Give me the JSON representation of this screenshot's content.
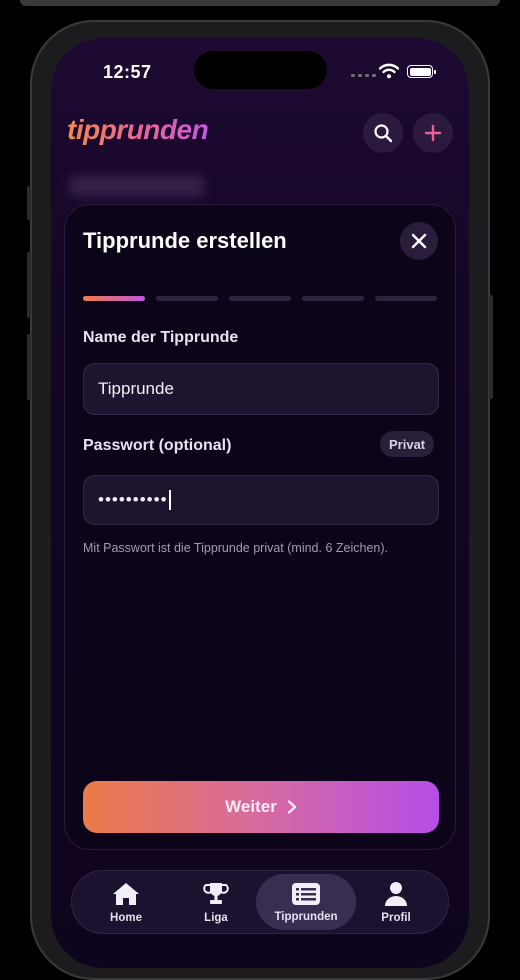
{
  "status": {
    "time": "12:57"
  },
  "app": {
    "logo": "tipprunden"
  },
  "header_actions": {
    "search_icon": "search-icon",
    "add_icon": "plus-icon"
  },
  "modal": {
    "title": "Tipprunde erstellen",
    "steps_total": 5,
    "step_current": 1,
    "name_label": "Name der Tipprunde",
    "name_value": "Tipprunde",
    "password_label": "Passwort (optional)",
    "privacy_badge": "Privat",
    "password_value": "••••••••••",
    "hint": "Mit Passwort ist die Tipprunde privat (mind. 6 Zeichen).",
    "next_button": "Weiter"
  },
  "tabs": [
    {
      "label": "Home",
      "icon": "home-icon"
    },
    {
      "label": "Liga",
      "icon": "trophy-icon"
    },
    {
      "label": "Tipprunden",
      "icon": "list-card-icon",
      "active": true
    },
    {
      "label": "Profil",
      "icon": "person-icon"
    }
  ],
  "colors": {
    "accent_start": "#ec7b47",
    "accent_end": "#b64ee8",
    "background": "#0f041d"
  }
}
